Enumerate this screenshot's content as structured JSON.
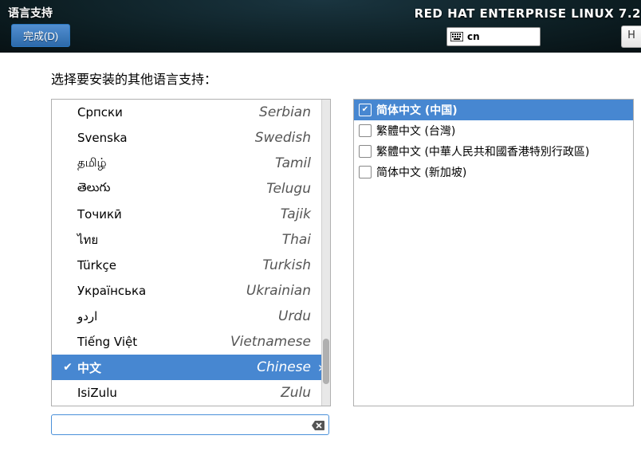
{
  "header": {
    "title": "语言支持",
    "done_label": "完成(D)",
    "product": "RED HAT ENTERPRISE LINUX 7.2",
    "keyboard_indicator": "cn",
    "help_label": "H"
  },
  "prompt": "选择要安装的其他语言支持：",
  "languages": [
    {
      "native": "Српски",
      "english": "Serbian",
      "selected": false,
      "checked": false
    },
    {
      "native": "Svenska",
      "english": "Swedish",
      "selected": false,
      "checked": false
    },
    {
      "native": "தமிழ்",
      "english": "Tamil",
      "selected": false,
      "checked": false
    },
    {
      "native": "తెలుగు",
      "english": "Telugu",
      "selected": false,
      "checked": false
    },
    {
      "native": "Точикӣ",
      "english": "Tajik",
      "selected": false,
      "checked": false
    },
    {
      "native": "ไทย",
      "english": "Thai",
      "selected": false,
      "checked": false
    },
    {
      "native": "Türkçe",
      "english": "Turkish",
      "selected": false,
      "checked": false
    },
    {
      "native": "Українська",
      "english": "Ukrainian",
      "selected": false,
      "checked": false
    },
    {
      "native": "اردو",
      "english": "Urdu",
      "selected": false,
      "checked": false
    },
    {
      "native": "Tiếng Việt",
      "english": "Vietnamese",
      "selected": false,
      "checked": false
    },
    {
      "native": "中文",
      "english": "Chinese",
      "selected": true,
      "checked": true
    },
    {
      "native": "IsiZulu",
      "english": "Zulu",
      "selected": false,
      "checked": false
    }
  ],
  "scrollbar": {
    "thumb_top_pct": 78,
    "thumb_height_pct": 15
  },
  "search": {
    "value": ""
  },
  "variants": [
    {
      "label": "简体中文 (中国)",
      "checked": true,
      "selected": true
    },
    {
      "label": "繁體中文 (台灣)",
      "checked": false,
      "selected": false
    },
    {
      "label": "繁體中文 (中華人民共和國香港特別行政區)",
      "checked": false,
      "selected": false
    },
    {
      "label": "简体中文 (新加坡)",
      "checked": false,
      "selected": false
    }
  ]
}
